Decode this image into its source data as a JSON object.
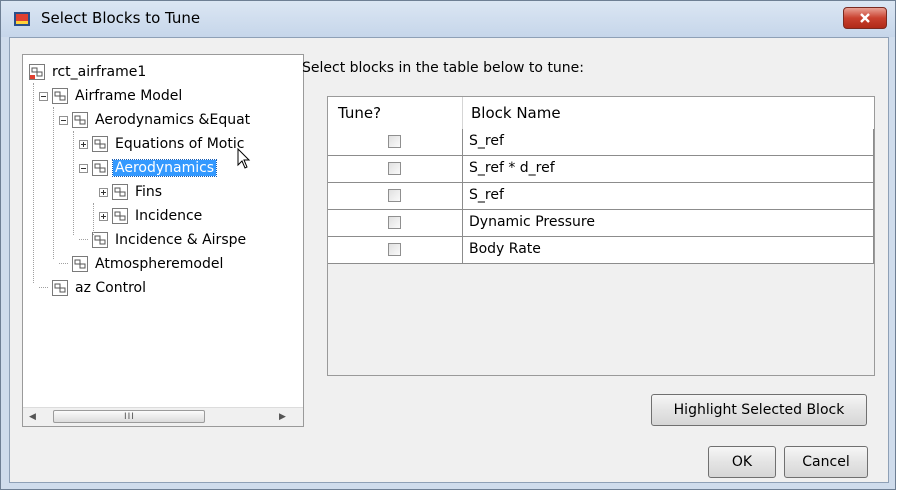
{
  "window": {
    "title": "Select Blocks to Tune"
  },
  "tree": {
    "items": [
      {
        "label": "rct_airframe1",
        "level": 0,
        "expander": "none",
        "icon": "model-icon"
      },
      {
        "label": "Airframe Model",
        "level": 1,
        "expander": "minus",
        "icon": "subsystem-icon"
      },
      {
        "label": "Aerodynamics &Equat",
        "level": 2,
        "expander": "minus",
        "icon": "subsystem-icon"
      },
      {
        "label": "Equations of Motic",
        "level": 3,
        "expander": "plus",
        "icon": "subsystem-icon"
      },
      {
        "label": "Aerodynamics",
        "level": 3,
        "expander": "minus",
        "icon": "subsystem-icon",
        "selected": true
      },
      {
        "label": "Fins",
        "level": 4,
        "expander": "plus",
        "icon": "subsystem-icon"
      },
      {
        "label": "Incidence",
        "level": 4,
        "expander": "plus",
        "icon": "subsystem-icon"
      },
      {
        "label": "Incidence & Airspe",
        "level": 3,
        "expander": "none",
        "icon": "subsystem-icon"
      },
      {
        "label": "Atmospheremodel",
        "level": 2,
        "expander": "none",
        "icon": "subsystem-icon"
      },
      {
        "label": "az Control",
        "level": 1,
        "expander": "none",
        "icon": "subsystem-icon"
      }
    ],
    "scroll_grip": "III"
  },
  "instruction": "Select blocks in the table below to tune:",
  "table": {
    "columns": [
      "Tune?",
      "Block Name"
    ],
    "rows": [
      {
        "tune": false,
        "name": "S_ref"
      },
      {
        "tune": false,
        "name": "S_ref * d_ref"
      },
      {
        "tune": false,
        "name": "S_ref"
      },
      {
        "tune": false,
        "name": "Dynamic Pressure"
      },
      {
        "tune": false,
        "name": "Body Rate"
      }
    ]
  },
  "buttons": {
    "highlight": "Highlight Selected Block",
    "ok": "OK",
    "cancel": "Cancel"
  },
  "colors": {
    "selection": "#3399ff",
    "close_button": "#c9412f",
    "window_frame": "#cfdcec"
  }
}
